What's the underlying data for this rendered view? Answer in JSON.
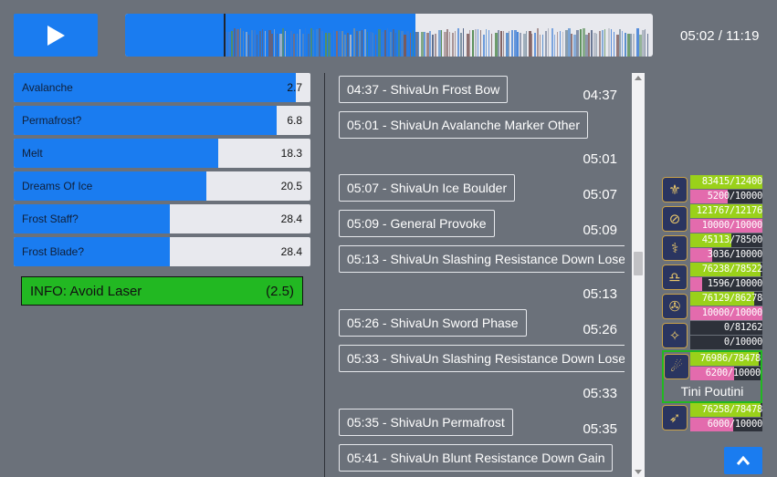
{
  "player": {
    "play_icon": "play-icon",
    "time_readout": "05:02 / 11:19",
    "timeline_progress": 0.55,
    "cursor_fraction": 0.187
  },
  "timers": [
    {
      "label": "Avalanche",
      "value": "2.7",
      "fill": 0.95
    },
    {
      "label": "Permafrost?",
      "value": "6.8",
      "fill": 0.885
    },
    {
      "label": "Melt",
      "value": "18.3",
      "fill": 0.69
    },
    {
      "label": "Dreams Of Ice",
      "value": "20.5",
      "fill": 0.65
    },
    {
      "label": "Frost Staff?",
      "value": "28.4",
      "fill": 0.525
    },
    {
      "label": "Frost Blade?",
      "value": "28.4",
      "fill": 0.525
    }
  ],
  "info": {
    "label": "INFO: Avoid Laser",
    "value": "(2.5)"
  },
  "events": [
    {
      "label": "04:37 - ShivaUn Frost Bow",
      "time": "04:37"
    },
    {
      "label": "05:01 - ShivaUn Avalanche Marker Other",
      "time": "05:01"
    },
    {
      "label": "05:07 - ShivaUn Ice Boulder",
      "time": "05:07"
    },
    {
      "label": "05:09 - General Provoke",
      "time": "05:09"
    },
    {
      "label": "05:13 - ShivaUn Slashing Resistance Down Lose",
      "time": "05:13"
    },
    {
      "label": "05:26 - ShivaUn Sword Phase",
      "time": "05:26"
    },
    {
      "label": "05:33 - ShivaUn Slashing Resistance Down Lose",
      "time": "05:33"
    },
    {
      "label": "05:35 - ShivaUn Permafrost",
      "time": "05:35"
    },
    {
      "label": "05:41 - ShivaUn Blunt Resistance Down Gain",
      "time": ""
    }
  ],
  "party": [
    {
      "icon": "paladin-job-icon",
      "glyph": "⚜",
      "hp": "83415/12400",
      "mp": "5200/10000",
      "hp_fill": 1.0,
      "mp_fill": 0.52
    },
    {
      "icon": "warrior-job-icon",
      "glyph": "⊘",
      "hp": "121767/12176",
      "mp": "10000/10000",
      "hp_fill": 1.0,
      "mp_fill": 1.0
    },
    {
      "icon": "white-mage-job-icon",
      "glyph": "⚕",
      "hp": "45113/78500",
      "mp": "3036/10000",
      "hp_fill": 0.575,
      "mp_fill": 0.3
    },
    {
      "icon": "scholar-job-icon",
      "glyph": "♎",
      "hp": "76238/78522",
      "mp": "1596/10000",
      "hp_fill": 0.97,
      "mp_fill": 0.16
    },
    {
      "icon": "monk-job-icon",
      "glyph": "✇",
      "hp": "76129/86278",
      "mp": "10000/10000",
      "hp_fill": 0.88,
      "mp_fill": 1.0
    },
    {
      "icon": "ninja-job-icon",
      "glyph": "✧",
      "hp": "0/81262",
      "mp": "0/10000",
      "hp_fill": 0.0,
      "mp_fill": 0.0
    },
    {
      "icon": "black-mage-job-icon",
      "glyph": "☄",
      "hp": "76986/78478",
      "mp": "6200/10000",
      "hp_fill": 0.98,
      "mp_fill": 0.62,
      "name": "Tini Poutini",
      "selected": true
    },
    {
      "icon": "bard-job-icon",
      "glyph": "➶",
      "hp": "76258/78478",
      "mp": "6000/10000",
      "hp_fill": 0.97,
      "mp_fill": 0.6
    }
  ],
  "colors": {
    "accent": "#1a7cf0",
    "info_green": "#22b822",
    "hp_green": "#9ad11a",
    "mp_pink": "#e36bad",
    "background": "#6b717a"
  },
  "scroll_to_top_icon": "chevron-up-icon"
}
